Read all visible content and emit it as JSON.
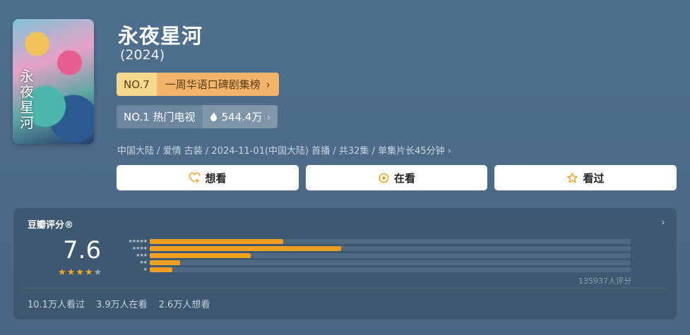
{
  "poster": {
    "title_vertical": "永夜星河"
  },
  "title": "永夜星河",
  "year": "(2024)",
  "rank_weekly": {
    "no": "NO.7",
    "label": "一周华语口碑剧集榜"
  },
  "rank_hot": {
    "no": "NO.1 热门电视",
    "heat": "544.4万"
  },
  "meta": "中国大陆 / 爱情 古装 / 2024-11-01(中国大陆) 首播 / 共32集 / 单集片长45分钟 ›",
  "actions": {
    "want": "想看",
    "watching": "在看",
    "watched": "看过"
  },
  "rating": {
    "title": "豆瓣评分®",
    "score": "7.6",
    "stars_on": "★★★★",
    "stars_off": "★",
    "row_labels": [
      "★★★★★",
      "★★★★",
      "★★★",
      "★★",
      "★"
    ],
    "distribution": [
      0.277,
      0.398,
      0.21,
      0.063,
      0.047
    ],
    "count": "135937人评分"
  },
  "stats": {
    "watched": "10.1万人看过",
    "watching": "3.9万人在看",
    "want": "2.6万人想看"
  }
}
